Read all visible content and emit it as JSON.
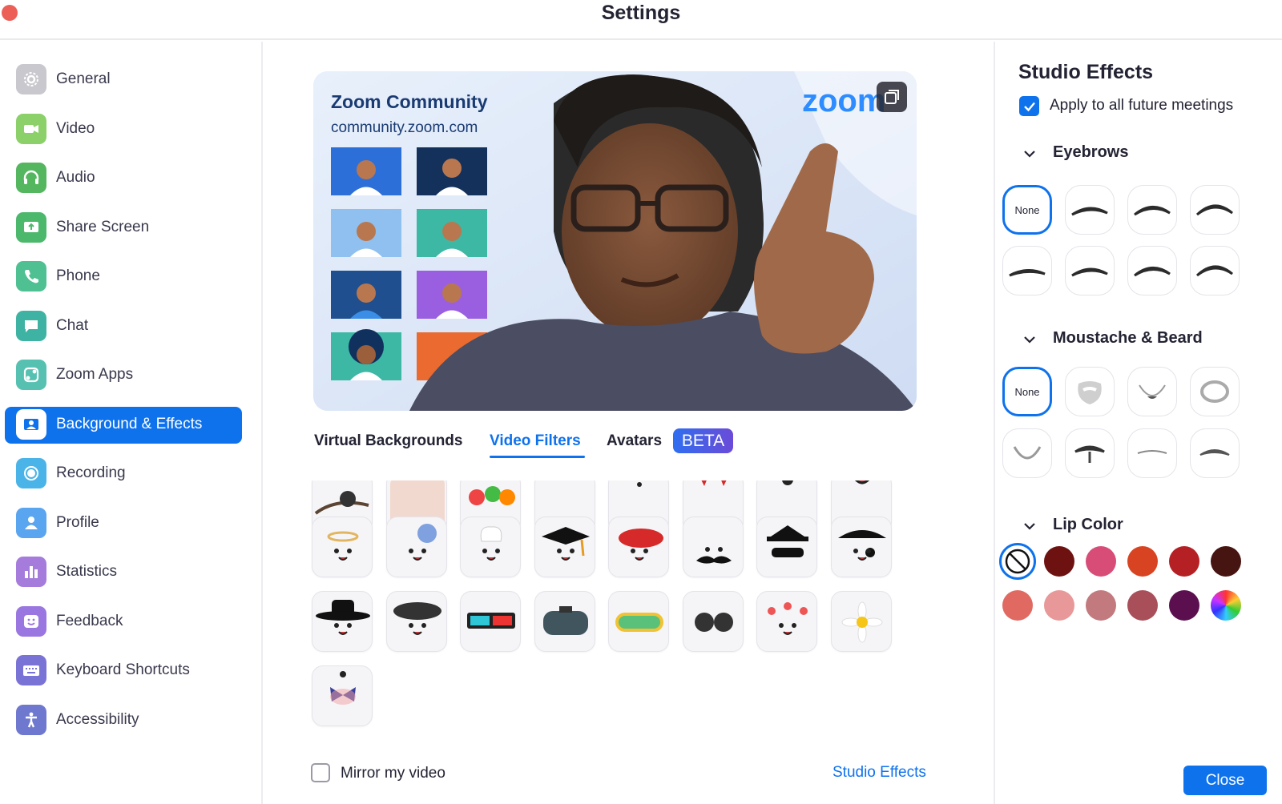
{
  "window": {
    "title": "Settings"
  },
  "sidebar": {
    "items": [
      {
        "label": "General",
        "icon": "gear-icon",
        "color": "#c8c8ce"
      },
      {
        "label": "Video",
        "icon": "video-camera-icon",
        "color": "#8bd068"
      },
      {
        "label": "Audio",
        "icon": "headphones-icon",
        "color": "#54b65e"
      },
      {
        "label": "Share Screen",
        "icon": "share-screen-icon",
        "color": "#4cb86b"
      },
      {
        "label": "Phone",
        "icon": "phone-icon",
        "color": "#4fc091"
      },
      {
        "label": "Chat",
        "icon": "chat-bubble-icon",
        "color": "#3fb3a3"
      },
      {
        "label": "Zoom Apps",
        "icon": "apps-icon",
        "color": "#56c1b1"
      },
      {
        "label": "Background & Effects",
        "icon": "portrait-icon",
        "color": "#ffffff"
      },
      {
        "label": "Recording",
        "icon": "record-icon",
        "color": "#4ab4e8"
      },
      {
        "label": "Profile",
        "icon": "profile-icon",
        "color": "#5aa5ef"
      },
      {
        "label": "Statistics",
        "icon": "bar-chart-icon",
        "color": "#a57cdc"
      },
      {
        "label": "Feedback",
        "icon": "smiley-icon",
        "color": "#9a76e0"
      },
      {
        "label": "Keyboard Shortcuts",
        "icon": "keyboard-icon",
        "color": "#7a73d6"
      },
      {
        "label": "Accessibility",
        "icon": "accessibility-icon",
        "color": "#6f78cf"
      }
    ],
    "active_index": 7
  },
  "preview": {
    "community_title": "Zoom Community",
    "community_url": "community.zoom.com",
    "brand_logo": "zoom"
  },
  "tabs": [
    {
      "label": "Virtual Backgrounds"
    },
    {
      "label": "Video Filters"
    },
    {
      "label": "Avatars"
    }
  ],
  "active_tab": "Video Filters",
  "beta_badge": "BETA",
  "filters": {
    "rows": [
      [
        "branch-icon",
        "pink-frame-icon",
        "lollipops-icon",
        "black-bar-icon",
        "dots-face-icon",
        "red-horns-icon",
        "black-eye-icon",
        "smile-face-icon"
      ],
      [
        "halo-face-icon",
        "flower-face-icon",
        "chef-hat-icon",
        "graduation-cap-icon",
        "red-beret-icon",
        "moustache-face-icon",
        "bandit-mask-icon",
        "pirate-hat-icon"
      ],
      [
        "black-hat-icon",
        "black-beret-icon",
        "3d-glasses-icon",
        "vr-headset-icon",
        "ski-goggles-icon",
        "round-sunglasses-icon",
        "flower-crown-icon",
        "daisy-icon"
      ],
      [
        "butterfly-icon"
      ]
    ]
  },
  "mirror": {
    "label": "Mirror my video",
    "checked": false
  },
  "studio_effects_link": "Studio Effects",
  "studio": {
    "title": "Studio Effects",
    "apply_label": "Apply to all future meetings",
    "apply_checked": true,
    "eyebrows": {
      "heading": "Eyebrows",
      "none_label": "None"
    },
    "beard": {
      "heading": "Moustache & Beard",
      "none_label": "None"
    },
    "lip": {
      "heading": "Lip Color",
      "colors": [
        "#6e1111",
        "#d84d78",
        "#d84421",
        "#b52025",
        "#461411",
        "#e06a62",
        "#e89898",
        "#c27a7f",
        "#a84f5a",
        "#5c0f4f"
      ]
    },
    "close_label": "Close"
  }
}
